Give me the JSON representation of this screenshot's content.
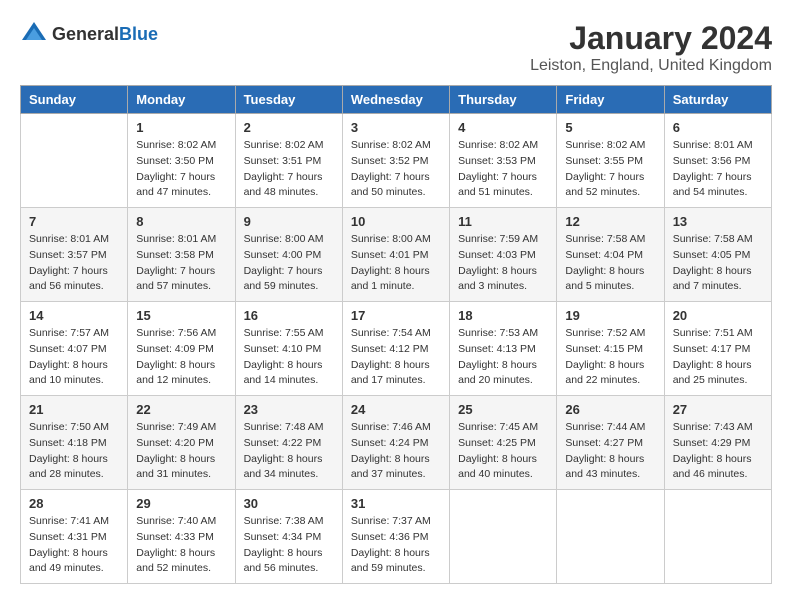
{
  "header": {
    "logo_general": "General",
    "logo_blue": "Blue",
    "title": "January 2024",
    "subtitle": "Leiston, England, United Kingdom"
  },
  "days_of_week": [
    "Sunday",
    "Monday",
    "Tuesday",
    "Wednesday",
    "Thursday",
    "Friday",
    "Saturday"
  ],
  "weeks": [
    [
      {
        "day": "",
        "info": ""
      },
      {
        "day": "1",
        "info": "Sunrise: 8:02 AM\nSunset: 3:50 PM\nDaylight: 7 hours\nand 47 minutes."
      },
      {
        "day": "2",
        "info": "Sunrise: 8:02 AM\nSunset: 3:51 PM\nDaylight: 7 hours\nand 48 minutes."
      },
      {
        "day": "3",
        "info": "Sunrise: 8:02 AM\nSunset: 3:52 PM\nDaylight: 7 hours\nand 50 minutes."
      },
      {
        "day": "4",
        "info": "Sunrise: 8:02 AM\nSunset: 3:53 PM\nDaylight: 7 hours\nand 51 minutes."
      },
      {
        "day": "5",
        "info": "Sunrise: 8:02 AM\nSunset: 3:55 PM\nDaylight: 7 hours\nand 52 minutes."
      },
      {
        "day": "6",
        "info": "Sunrise: 8:01 AM\nSunset: 3:56 PM\nDaylight: 7 hours\nand 54 minutes."
      }
    ],
    [
      {
        "day": "7",
        "info": "Sunrise: 8:01 AM\nSunset: 3:57 PM\nDaylight: 7 hours\nand 56 minutes."
      },
      {
        "day": "8",
        "info": "Sunrise: 8:01 AM\nSunset: 3:58 PM\nDaylight: 7 hours\nand 57 minutes."
      },
      {
        "day": "9",
        "info": "Sunrise: 8:00 AM\nSunset: 4:00 PM\nDaylight: 7 hours\nand 59 minutes."
      },
      {
        "day": "10",
        "info": "Sunrise: 8:00 AM\nSunset: 4:01 PM\nDaylight: 8 hours\nand 1 minute."
      },
      {
        "day": "11",
        "info": "Sunrise: 7:59 AM\nSunset: 4:03 PM\nDaylight: 8 hours\nand 3 minutes."
      },
      {
        "day": "12",
        "info": "Sunrise: 7:58 AM\nSunset: 4:04 PM\nDaylight: 8 hours\nand 5 minutes."
      },
      {
        "day": "13",
        "info": "Sunrise: 7:58 AM\nSunset: 4:05 PM\nDaylight: 8 hours\nand 7 minutes."
      }
    ],
    [
      {
        "day": "14",
        "info": "Sunrise: 7:57 AM\nSunset: 4:07 PM\nDaylight: 8 hours\nand 10 minutes."
      },
      {
        "day": "15",
        "info": "Sunrise: 7:56 AM\nSunset: 4:09 PM\nDaylight: 8 hours\nand 12 minutes."
      },
      {
        "day": "16",
        "info": "Sunrise: 7:55 AM\nSunset: 4:10 PM\nDaylight: 8 hours\nand 14 minutes."
      },
      {
        "day": "17",
        "info": "Sunrise: 7:54 AM\nSunset: 4:12 PM\nDaylight: 8 hours\nand 17 minutes."
      },
      {
        "day": "18",
        "info": "Sunrise: 7:53 AM\nSunset: 4:13 PM\nDaylight: 8 hours\nand 20 minutes."
      },
      {
        "day": "19",
        "info": "Sunrise: 7:52 AM\nSunset: 4:15 PM\nDaylight: 8 hours\nand 22 minutes."
      },
      {
        "day": "20",
        "info": "Sunrise: 7:51 AM\nSunset: 4:17 PM\nDaylight: 8 hours\nand 25 minutes."
      }
    ],
    [
      {
        "day": "21",
        "info": "Sunrise: 7:50 AM\nSunset: 4:18 PM\nDaylight: 8 hours\nand 28 minutes."
      },
      {
        "day": "22",
        "info": "Sunrise: 7:49 AM\nSunset: 4:20 PM\nDaylight: 8 hours\nand 31 minutes."
      },
      {
        "day": "23",
        "info": "Sunrise: 7:48 AM\nSunset: 4:22 PM\nDaylight: 8 hours\nand 34 minutes."
      },
      {
        "day": "24",
        "info": "Sunrise: 7:46 AM\nSunset: 4:24 PM\nDaylight: 8 hours\nand 37 minutes."
      },
      {
        "day": "25",
        "info": "Sunrise: 7:45 AM\nSunset: 4:25 PM\nDaylight: 8 hours\nand 40 minutes."
      },
      {
        "day": "26",
        "info": "Sunrise: 7:44 AM\nSunset: 4:27 PM\nDaylight: 8 hours\nand 43 minutes."
      },
      {
        "day": "27",
        "info": "Sunrise: 7:43 AM\nSunset: 4:29 PM\nDaylight: 8 hours\nand 46 minutes."
      }
    ],
    [
      {
        "day": "28",
        "info": "Sunrise: 7:41 AM\nSunset: 4:31 PM\nDaylight: 8 hours\nand 49 minutes."
      },
      {
        "day": "29",
        "info": "Sunrise: 7:40 AM\nSunset: 4:33 PM\nDaylight: 8 hours\nand 52 minutes."
      },
      {
        "day": "30",
        "info": "Sunrise: 7:38 AM\nSunset: 4:34 PM\nDaylight: 8 hours\nand 56 minutes."
      },
      {
        "day": "31",
        "info": "Sunrise: 7:37 AM\nSunset: 4:36 PM\nDaylight: 8 hours\nand 59 minutes."
      },
      {
        "day": "",
        "info": ""
      },
      {
        "day": "",
        "info": ""
      },
      {
        "day": "",
        "info": ""
      }
    ]
  ]
}
